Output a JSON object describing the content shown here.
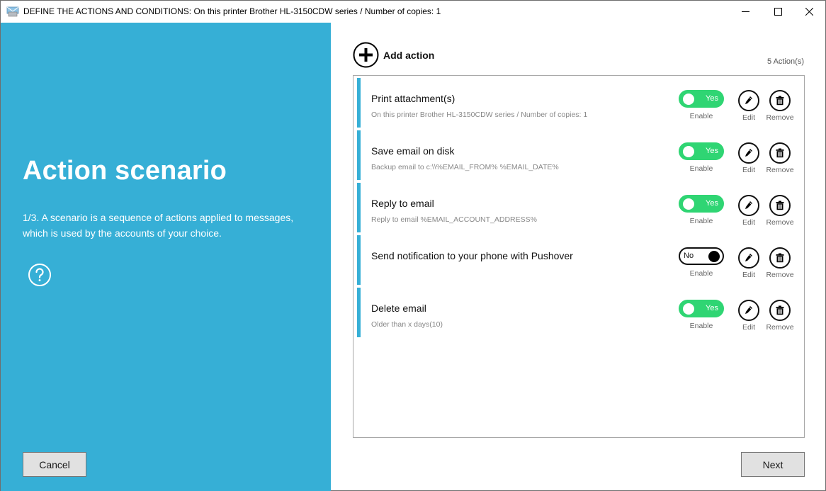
{
  "window": {
    "title": "DEFINE THE ACTIONS AND CONDITIONS: On this printer Brother HL-3150CDW series / Number of copies: 1",
    "app_icon": "mail-printer-icon",
    "controls": {
      "minimize": "minimize-icon",
      "maximize": "maximize-icon",
      "close": "close-icon"
    }
  },
  "left_panel": {
    "title": "Action scenario",
    "description": "1/3. A scenario is a sequence of actions applied to messages, which is used by the accounts of your choice.",
    "help_icon": "question-circle-icon",
    "cancel_label": "Cancel",
    "background_color": "#36afd6"
  },
  "main": {
    "add_action_label": "Add action",
    "action_count": "5  Action(s)",
    "actions": [
      {
        "title": "Print attachment(s)",
        "subtitle": "On this printer Brother HL-3150CDW series / Number of copies: 1",
        "enabled": true,
        "toggle_label": "Yes",
        "enable_caption": "Enable",
        "edit_caption": "Edit",
        "remove_caption": "Remove"
      },
      {
        "title": "Save email on disk",
        "subtitle": "Backup email to c:\\\\%EMAIL_FROM% %EMAIL_DATE%",
        "enabled": true,
        "toggle_label": "Yes",
        "enable_caption": "Enable",
        "edit_caption": "Edit",
        "remove_caption": "Remove"
      },
      {
        "title": "Reply to email",
        "subtitle": "Reply to email %EMAIL_ACCOUNT_ADDRESS%",
        "enabled": true,
        "toggle_label": "Yes",
        "enable_caption": "Enable",
        "edit_caption": "Edit",
        "remove_caption": "Remove"
      },
      {
        "title": "Send notification to your phone with Pushover",
        "subtitle": "",
        "enabled": false,
        "toggle_label": "No",
        "enable_caption": "Enable",
        "edit_caption": "Edit",
        "remove_caption": "Remove"
      },
      {
        "title": "Delete email",
        "subtitle": "Older than x days(10)",
        "enabled": true,
        "toggle_label": "Yes",
        "enable_caption": "Enable",
        "edit_caption": "Edit",
        "remove_caption": "Remove"
      }
    ],
    "next_label": "Next",
    "colors": {
      "accent": "#36afd6",
      "toggle_on": "#2fd573"
    }
  }
}
